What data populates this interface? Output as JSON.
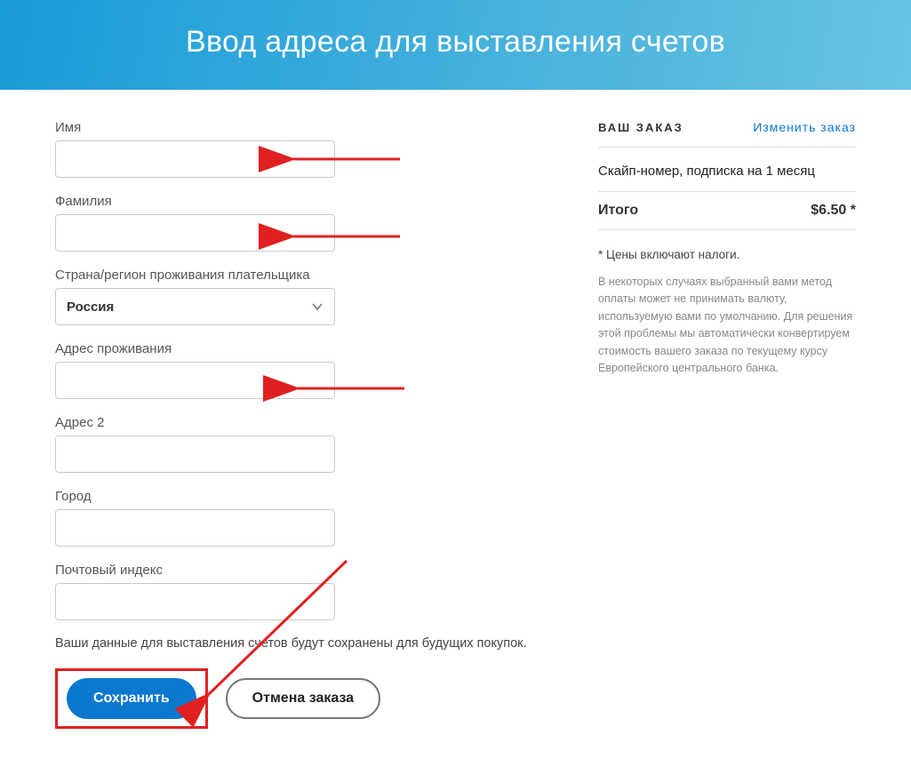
{
  "header": {
    "title": "Ввод адреса для выставления счетов"
  },
  "form": {
    "first_name": {
      "label": "Имя",
      "value": ""
    },
    "last_name": {
      "label": "Фамилия",
      "value": ""
    },
    "country": {
      "label": "Страна/регион проживания плательщика",
      "selected": "Россия"
    },
    "address1": {
      "label": "Адрес проживания",
      "value": ""
    },
    "address2": {
      "label": "Адрес 2",
      "value": ""
    },
    "city": {
      "label": "Город",
      "value": ""
    },
    "postal": {
      "label": "Почтовый индекс",
      "value": ""
    },
    "note": "Ваши данные для выставления счетов будут сохранены для будущих покупок.",
    "save_label": "Сохранить",
    "cancel_label": "Отмена заказа"
  },
  "order": {
    "heading": "ВАШ ЗАКАЗ",
    "change_link": "Изменить заказ",
    "item": "Скайп-номер, подписка на 1 месяц",
    "total_label": "Итого",
    "total_value": "$6.50 *",
    "tax_note": "* Цены включают налоги.",
    "currency_note": "В некоторых случаях выбранный вами метод оплаты может не принимать валюту, используемую вами по умолчанию. Для решения этой проблемы мы автоматически конвертируем стоимость вашего заказа по текущему курсу Европейского центрального банка."
  }
}
